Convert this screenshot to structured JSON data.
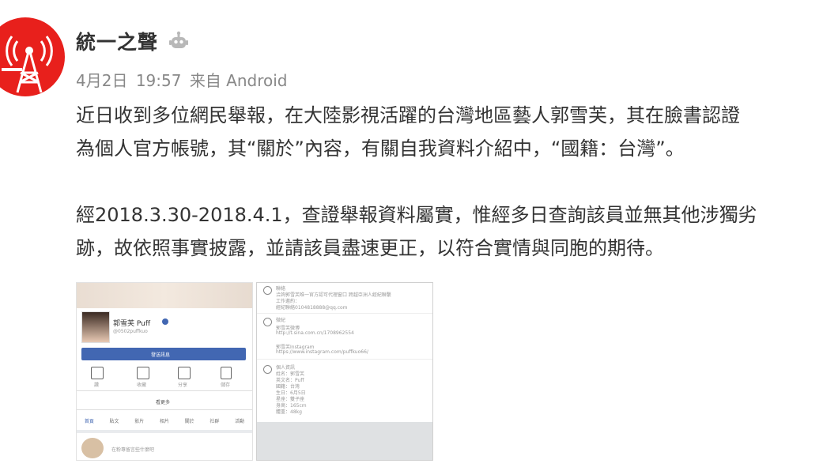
{
  "post": {
    "username": "統一之聲",
    "date": "4月2日",
    "time": "19:57",
    "source": "来自 Android",
    "paragraphs": [
      [
        "近日收到多位網民舉報，在大陸影視活躍的台灣地區藝人郭雪芙，其在臉書認證",
        "為個人官方帳號，其“關於”內容，有關自我資料介紹中，“國籍：台灣”。"
      ],
      [
        "經2018.3.30-2018.4.1，查證舉報資料屬實，惟經多日查詢該員並無其他涉獨劣",
        "跡，故依照事實披露，並請該員盡速更正，以符合實情與同胞的期待。"
      ]
    ]
  },
  "screenshot_left": {
    "profile_name": "郭雪芙 Puff",
    "handle": "@0502puffkuo",
    "send_message_button": "發送訊息",
    "actions": [
      "讚",
      "收藏",
      "分享",
      "儲存"
    ],
    "more": "看更多",
    "tabs": [
      "首頁",
      "貼文",
      "影片",
      "相片",
      "關於",
      "社群",
      "活動"
    ],
    "post_placeholder": "在粉專留言些什麼吧"
  },
  "screenshot_right": {
    "contact_title": "聯絡",
    "contact_line1": "洽詢郭雪芙唯一官方認可代理窗口 跨越亞洲人經紀聯繫",
    "contact_line2": "工作邀約：",
    "contact_line3": "經紀聯絡0104818888@qq.com",
    "links_title": "微紀",
    "links_line1": "郭雪芙微博",
    "links_line2": "http://t.sina.com.cn/1708962554",
    "ig_title": "郭雪芙Instagram",
    "ig_line": "https://www.instagram.com/puffkuo66/",
    "personal_title": "個人資訊",
    "personal_lines": [
      "姓名：郭雪芙",
      "英文名：Puff",
      "國籍：台灣",
      "生日：6月5日",
      "星座：雙子座",
      "身高：165cm",
      "體重：48kg"
    ]
  },
  "colors": {
    "avatar_red": "#e8201c",
    "fb_blue": "#4267b2",
    "meta_gray": "#888888"
  }
}
